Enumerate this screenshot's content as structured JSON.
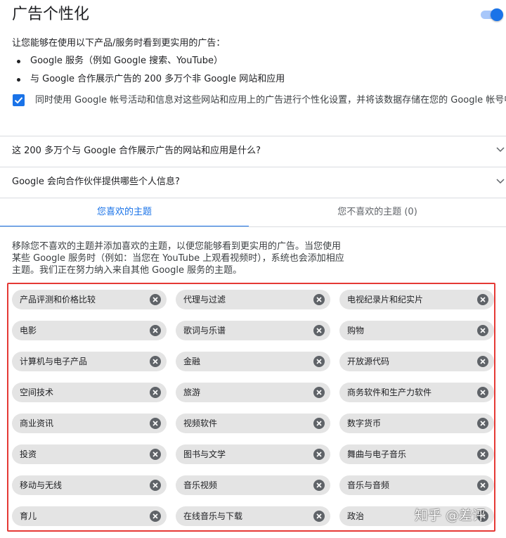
{
  "header": {
    "title": "广告个性化",
    "toggle_on": true
  },
  "intro": "让您能够在使用以下产品/服务时看到更实用的广告：",
  "bullets": [
    "Google 服务（例如 Google 搜索、YouTube）",
    "与 Google 合作展示广告的 200 多万个非 Google 网站和应用"
  ],
  "checkbox": {
    "checked": true,
    "label": "同时使用 Google 帐号活动和信息对这些网站和应用上的广告进行个性化设置，并将该数据存储在您的 Google 帐号中"
  },
  "faqs": [
    {
      "question": "这 200 多万个与 Google 合作展示广告的网站和应用是什么?"
    },
    {
      "question": "Google 会向合作伙伴提供哪些个人信息?"
    }
  ],
  "tabs": {
    "liked": "您喜欢的主题",
    "disliked": "您不喜欢的主题 (0)"
  },
  "description": "移除您不喜欢的主题并添加喜欢的主题，以便您能够看到更实用的广告。当您使用某些 Google 服务时（例如：当您在 YouTube 上观看视频时），系统也会添加相应主题。我们正在努力纳入来自其他 Google 服务的主题。",
  "topics": [
    [
      "产品评测和价格比较",
      "代理与过滤",
      "电视纪录片和纪实片"
    ],
    [
      "电影",
      "歌词与乐谱",
      "购物"
    ],
    [
      "计算机与电子产品",
      "金融",
      "开放源代码"
    ],
    [
      "空间技术",
      "旅游",
      "商务软件和生产力软件"
    ],
    [
      "商业资讯",
      "视频软件",
      "数字货币"
    ],
    [
      "投资",
      "图书与文学",
      "舞曲与电子音乐"
    ],
    [
      "移动与无线",
      "音乐视频",
      "音乐与音频"
    ],
    [
      "育儿",
      "在线音乐与下载",
      "政治"
    ]
  ],
  "watermark": "知乎 @差评",
  "colors": {
    "accent": "#1a73e8",
    "highlight_border": "#e53935",
    "chip_bg": "#e4e4e4"
  },
  "icons": {
    "toggle": "toggle-switch",
    "check": "checkmark-icon",
    "expand": "chevron-down-icon",
    "remove": "close-circle-icon"
  }
}
